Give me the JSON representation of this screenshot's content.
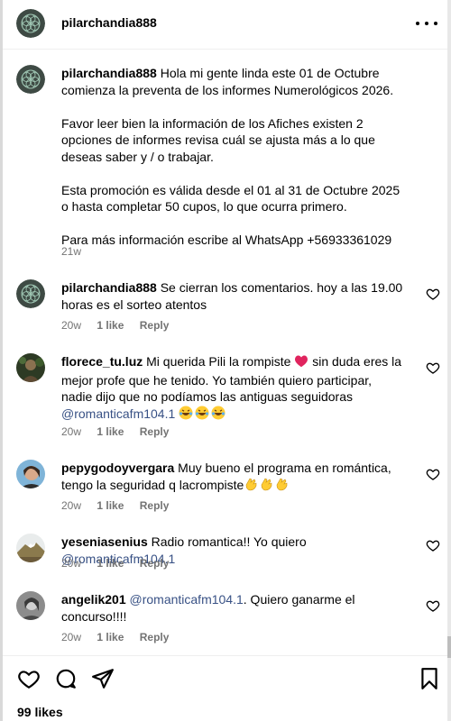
{
  "post": {
    "author": "pilarchandia888",
    "caption_author": "pilarchandia888",
    "caption_paragraphs": [
      "Hola mi gente linda este 01 de Octubre comienza la preventa de los informes Numerológicos 2026.",
      "Favor leer bien la información de los Afiches existen 2 opciones de informes revisa cuál se ajusta más a lo que deseas saber y / o trabajar.",
      "Esta promoción es válida desde el 01 al 31 de Octubre 2025 o hasta completar 50 cupos, lo que ocurra primero.",
      "Para más información escribe al WhatsApp +56933361029"
    ],
    "caption_time": "21w",
    "likes": "99 likes"
  },
  "comments": [
    {
      "username": "pilarchandia888",
      "text": "Se cierran los comentarios. hoy a las 19.00 horas es el sorteo atentos",
      "time": "20w",
      "likes": "1 like",
      "reply": "Reply"
    },
    {
      "username": "florece_tu.luz",
      "text_a": "Mi querida Pili la rompiste",
      "text_b": "sin duda eres la mejor profe que he tenido. Yo también quiero participar, nadie dijo que no podíamos las antiguas seguidoras",
      "mention": "@romanticafm104.1",
      "time": "20w",
      "likes": "1 like",
      "reply": "Reply"
    },
    {
      "username": "pepygodoyvergara",
      "text": "Muy bueno el programa en romántica, tengo la seguridad q lacrompiste",
      "time": "20w",
      "likes": "1 like",
      "reply": "Reply"
    },
    {
      "username": "yeseniasenius",
      "text": "Radio romantica!! Yo quiero",
      "mention": "@romanticafm104.1",
      "time": "20w",
      "likes": "1 like",
      "reply": "Reply"
    },
    {
      "username": "angelik201",
      "mention": "@romanticafm104.1",
      "text": ". Quiero ganarme el concurso!!!!",
      "time": "20w",
      "likes": "1 like",
      "reply": "Reply"
    }
  ],
  "icons": {
    "heart": "heart-icon",
    "comment": "comment-icon",
    "share": "share-icon",
    "save": "bookmark-icon",
    "more": "more-options-icon"
  },
  "colors": {
    "mention": "#385185",
    "meta": "#737373",
    "heart_red": "#e0245e"
  }
}
